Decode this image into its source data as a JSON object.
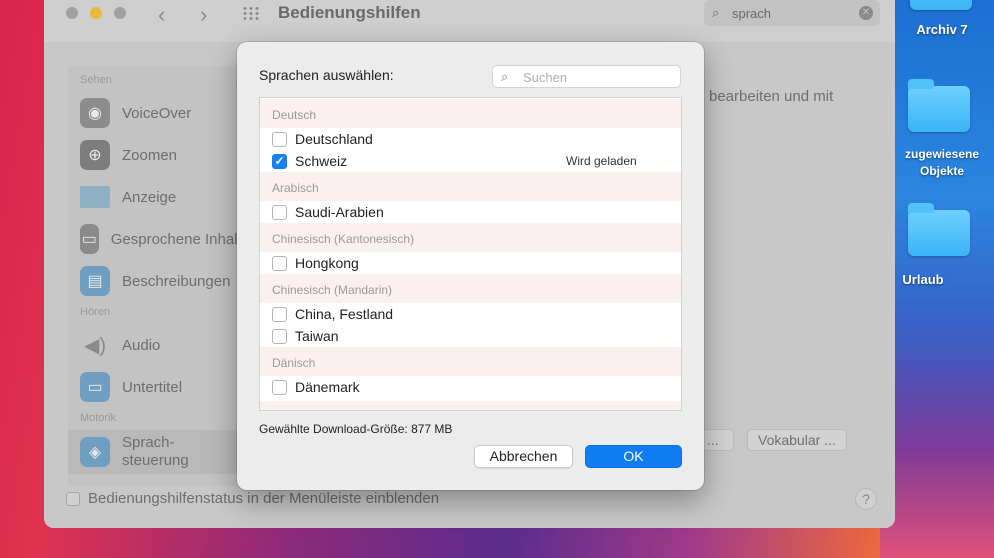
{
  "desktop": {
    "items": [
      {
        "label": "Archiv 7"
      },
      {
        "label": "zugewiesene Objekte"
      },
      {
        "label": "Urlaub"
      }
    ]
  },
  "window": {
    "title": "Bedienungshilfen",
    "search_value": "sprach",
    "sidebar": {
      "sections": [
        "Sehen",
        "Hören",
        "Motorik"
      ],
      "items": [
        {
          "label": "VoiceOver",
          "icon": "voiceover-icon"
        },
        {
          "label": "Zoomen",
          "icon": "zoom-icon"
        },
        {
          "label": "Anzeige",
          "icon": "display-icon"
        },
        {
          "label": "Gesprochene Inhalte",
          "icon": "speech-icon"
        },
        {
          "label": "Beschreibungen",
          "icon": "descriptions-icon"
        },
        {
          "label": "Audio",
          "icon": "audio-icon"
        },
        {
          "label": "Untertitel",
          "icon": "captions-icon"
        },
        {
          "label": "Sprach-\nsteuerung",
          "icon": "voice-control-icon"
        }
      ]
    },
    "main_text": "bearbeiten und mit",
    "vocab_button": "Vokabular ...",
    "menu_status_label": "Bedienungshilfenstatus in der Menüleiste einblenden",
    "help_label": "?"
  },
  "dialog": {
    "title": "Sprachen auswählen:",
    "search_placeholder": "Suchen",
    "groups": [
      {
        "header": "Deutsch",
        "items": [
          {
            "label": "Deutschland",
            "checked": false,
            "status": ""
          },
          {
            "label": "Schweiz",
            "checked": true,
            "status": "Wird geladen"
          }
        ]
      },
      {
        "header": "Arabisch",
        "items": [
          {
            "label": "Saudi-Arabien",
            "checked": false,
            "status": ""
          }
        ]
      },
      {
        "header": "Chinesisch (Kantonesisch)",
        "items": [
          {
            "label": "Hongkong",
            "checked": false,
            "status": ""
          }
        ]
      },
      {
        "header": "Chinesisch (Mandarin)",
        "items": [
          {
            "label": "China, Festland",
            "checked": false,
            "status": ""
          },
          {
            "label": "Taiwan",
            "checked": false,
            "status": ""
          }
        ]
      },
      {
        "header": "Dänisch",
        "items": [
          {
            "label": "Dänemark",
            "checked": false,
            "status": ""
          }
        ]
      }
    ],
    "download_size": "Gewählte Download-Größe: 877 MB",
    "cancel_label": "Abbrechen",
    "ok_label": "OK"
  },
  "colors": {
    "accent": "#0f7cf2",
    "group_header_bg": "#fbf0f0",
    "checkbox_checked": "#1a7ff0"
  }
}
